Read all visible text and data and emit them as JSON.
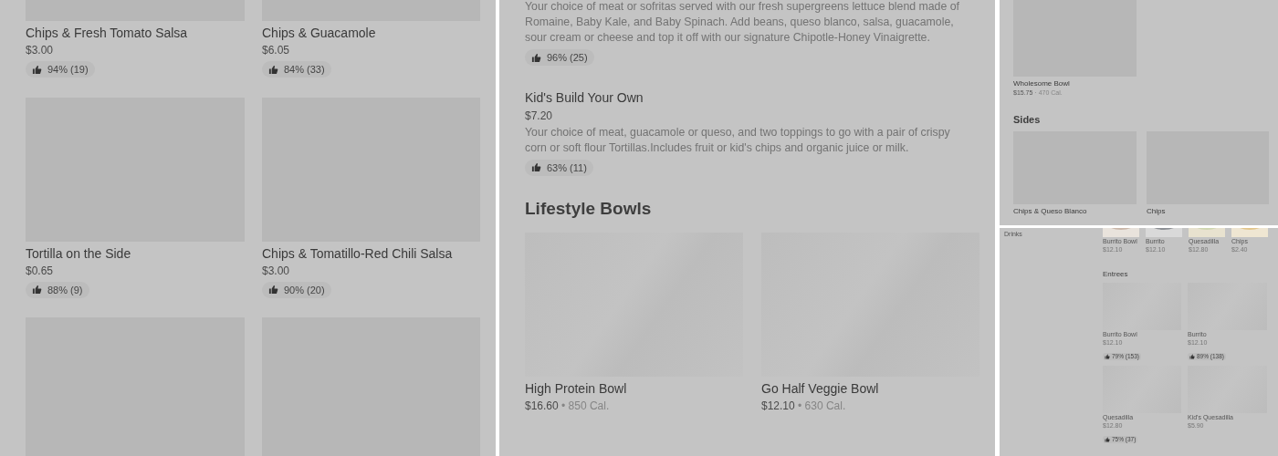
{
  "left_panel": {
    "items": [
      {
        "kind": "dish",
        "name": "Chips & Fresh Tomato Salsa",
        "price": "$3.00",
        "rating": "94% (19)"
      },
      {
        "kind": "dish",
        "name": "Chips & Guacamole",
        "price": "$6.05",
        "rating": "84% (33)"
      },
      {
        "kind": "dish",
        "name": "Tortilla on the Side",
        "price": "$0.65",
        "rating": "88% (9)"
      },
      {
        "kind": "dish",
        "name": "Chips & Tomatillo-Red Chili Salsa",
        "price": "$3.00",
        "rating": "90% (20)"
      },
      {
        "kind": "picture"
      },
      {
        "kind": "picture"
      }
    ]
  },
  "middle_panel": {
    "items": [
      {
        "description": "Your choice of meat or sofritas served with our fresh supergreens lettuce blend made of Romaine, Baby Kale, and Baby Spinach. Add beans, queso blanco, salsa, guacamole, sour cream or cheese and top it off with our signature Chipotle-Honey Vinaigrette.",
        "rating": "96% (25)"
      },
      {
        "name": "Kid's Build Your Own",
        "price": "$7.20",
        "description": "Your choice of meat, guacamole or queso, and two toppings to go with a pair of crispy corn or soft flour Tortillas.Includes fruit or kid's chips and organic juice or milk.",
        "rating": "63% (11)"
      }
    ],
    "section": {
      "title": "Lifestyle Bowls",
      "items": [
        {
          "name": "High Protein Bowl",
          "price": "$16.60",
          "calories": "• 850 Cal."
        },
        {
          "name": "Go Half Veggie Bowl",
          "price": "$12.10",
          "calories": "• 630 Cal."
        }
      ]
    }
  },
  "right_top_panel": {
    "items": [
      {
        "name": "Wholesome Bowl",
        "price": "$15.75",
        "calories": "· 470 Cal."
      }
    ],
    "section": {
      "title": "Sides",
      "items": [
        {
          "name": "Chips & Queso Blanco"
        },
        {
          "name": "Chips"
        }
      ]
    }
  },
  "right_bottom_panel": {
    "sidebar": {
      "items": [
        "Drinks"
      ]
    },
    "featured": [
      {
        "name": "Burrito Bowl",
        "price": "$12.10"
      },
      {
        "name": "Burrito",
        "price": "$12.10"
      },
      {
        "name": "Quesadilla",
        "price": "$12.80"
      },
      {
        "name": "Chips",
        "price": "$2.40"
      }
    ],
    "section": {
      "title": "Entrees",
      "items": [
        {
          "name": "Burrito Bowl",
          "price": "$12.10",
          "rating": "79% (153)"
        },
        {
          "name": "Burrito",
          "price": "$12.10",
          "rating": "89% (138)"
        },
        {
          "name": "Quesadilla",
          "price": "$12.80",
          "rating": "75% (37)"
        },
        {
          "name": "Kid's Quesadilla",
          "price": "$5.90"
        }
      ]
    }
  }
}
